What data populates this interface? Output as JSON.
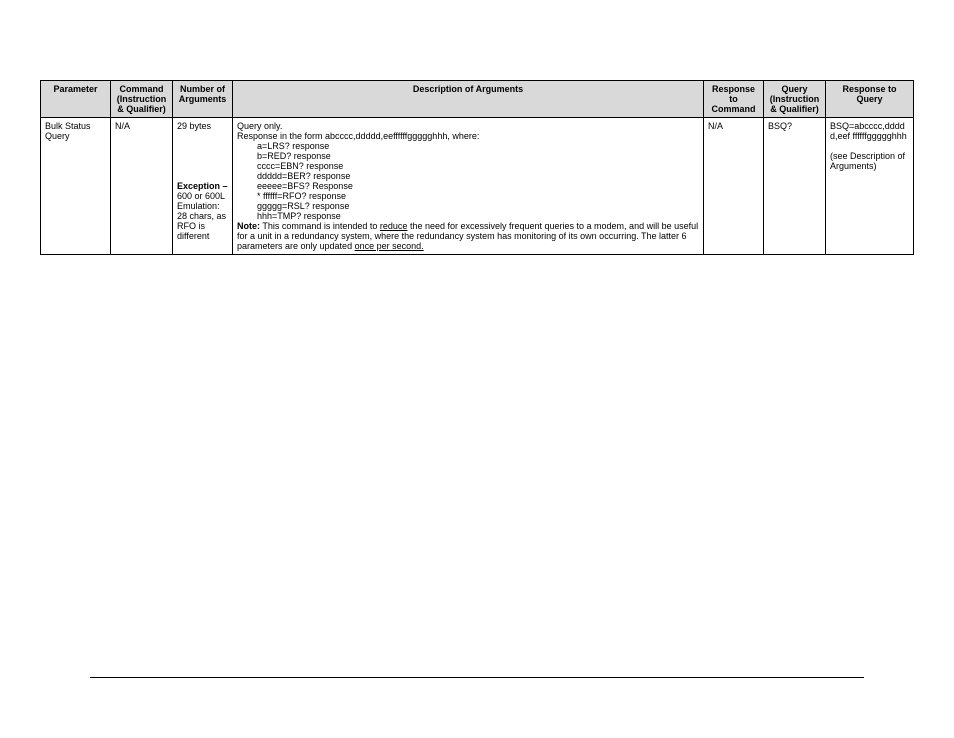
{
  "headers": {
    "parameter": "Parameter",
    "command": "Command (Instruction & Qualifier)",
    "numargs": "Number of Arguments",
    "desc": "Description of Arguments",
    "rescmd": "Response to Command",
    "query": "Query (Instruction & Qualifier)",
    "resquery": "Response to Query"
  },
  "row": {
    "parameter": "Bulk Status Query",
    "command": "N/A",
    "numargs_line1": "29 bytes",
    "numargs_exception_label": "Exception –",
    "numargs_exception_body": "600 or 600L Emulation: 28 chars, as RFO is different",
    "desc_intro": "Query only.",
    "desc_form": "Response in the form abcccc,ddddd,eeffffffggggghhh, where:",
    "desc_a": "a=LRS? response",
    "desc_b": "b=RED? response",
    "desc_c": "cccc=EBN? response",
    "desc_d": "ddddd=BER? response",
    "desc_e": "eeeee=BFS? Response",
    "desc_f": "* ffffff=RFO? response",
    "desc_g": "ggggg=RSL? response",
    "desc_h": "hhh=TMP? response",
    "desc_note_label": "Note:",
    "desc_note_pre": " This command is intended to ",
    "desc_note_reduce": "reduce",
    "desc_note_mid": " the need for excessively frequent queries to a modem, and will be useful for a unit in a redundancy system, where the redundancy system has monitoring of its own occurring. The latter 6 parameters are only updated ",
    "desc_note_once": "once per second.",
    "rescmd": "N/A",
    "query": "BSQ?",
    "resq_line1": "BSQ=abcccc,ddddd,eef ffffffggggghhh",
    "resq_line2": "(see Description of Arguments)"
  }
}
